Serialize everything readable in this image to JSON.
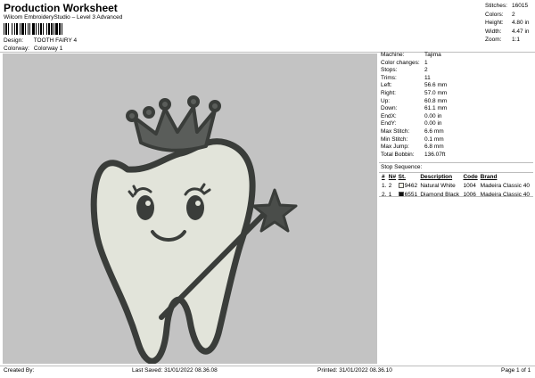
{
  "header": {
    "title": "Production Worksheet",
    "subtitle": "Wilcom EmbroideryStudio – Level 3 Advanced",
    "design_label": "Design:",
    "design_value": "TOOTH FAIRY 4",
    "colorway_label": "Colorway:",
    "colorway_value": "Colorway 1"
  },
  "summary": [
    {
      "label": "Stitches:",
      "value": "16015"
    },
    {
      "label": "Colors:",
      "value": "2"
    },
    {
      "label": "Height:",
      "value": "4.80 in"
    },
    {
      "label": "Width:",
      "value": "4.47 in"
    },
    {
      "label": "Zoom:",
      "value": "1:1"
    }
  ],
  "properties": [
    {
      "label": "Machine:",
      "value": "Tajima"
    },
    {
      "label": "Color changes:",
      "value": "1"
    },
    {
      "label": "Stops:",
      "value": "2"
    },
    {
      "label": "Trims:",
      "value": "11"
    },
    {
      "label": "Left:",
      "value": "56.6 mm"
    },
    {
      "label": "Right:",
      "value": "57.0 mm"
    },
    {
      "label": "Up:",
      "value": "60.8 mm"
    },
    {
      "label": "Down:",
      "value": "61.1 mm"
    },
    {
      "label": "EndX:",
      "value": "0.00 in"
    },
    {
      "label": "EndY:",
      "value": "0.00 in"
    },
    {
      "label": "Max Stitch:",
      "value": "6.6 mm"
    },
    {
      "label": "Min Stitch:",
      "value": "0.1 mm"
    },
    {
      "label": "Max Jump:",
      "value": "6.8 mm"
    },
    {
      "label": "Total Bobbin:",
      "value": "136.07ft"
    }
  ],
  "stop_sequence": {
    "title": "Stop Sequence:",
    "headers": [
      "#",
      "N#",
      "St.",
      "Description",
      "Code",
      "Brand"
    ],
    "rows": [
      {
        "num": "1.",
        "n": "2",
        "swatch": "#f4f1e6",
        "st": "9462",
        "desc": "Natural White",
        "code": "1004",
        "brand": "Madeira Classic 40"
      },
      {
        "num": "2.",
        "n": "1",
        "swatch": "#111111",
        "st": "6551",
        "desc": "Diamond Black",
        "code": "1006",
        "brand": "Madeira Classic 40"
      }
    ]
  },
  "footer": {
    "created_by": "Created By:",
    "last_saved": "Last Saved: 31/01/2022 08.36.08",
    "printed": "Printed: 31/01/2022 08.36.10",
    "page": "Page 1 of 1"
  },
  "colors": {
    "canvas_bg": "#c3c3c3",
    "outline": "#3a3d3a",
    "fill": "#e2e4da"
  }
}
